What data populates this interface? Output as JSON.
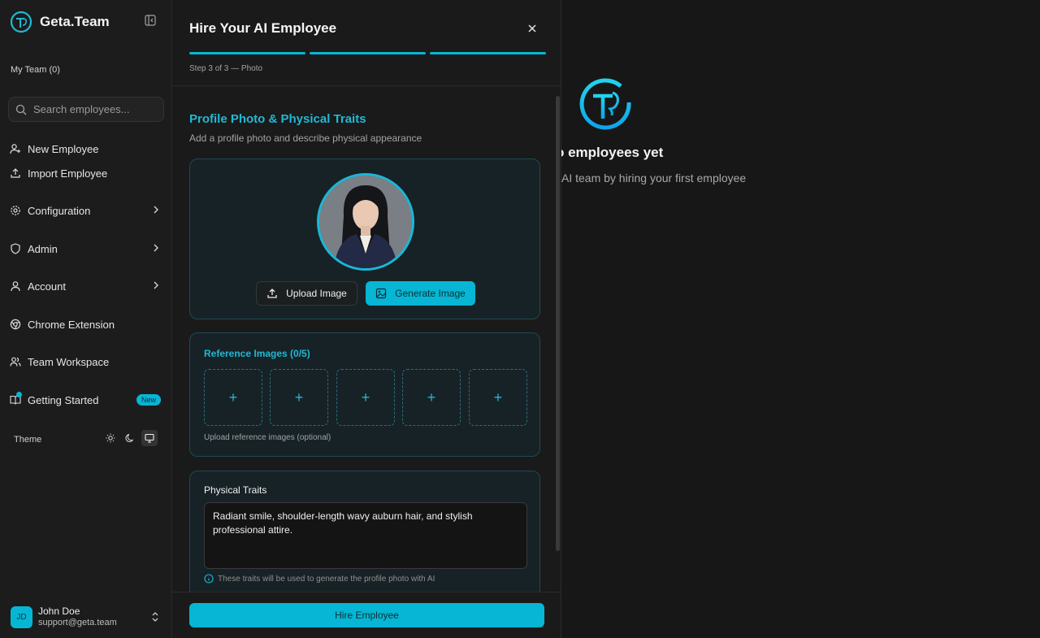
{
  "brand": {
    "name": "Geta.Team"
  },
  "sidebar": {
    "team_label": "My Team (0)",
    "search_placeholder": "Search employees...",
    "items": [
      {
        "label": "New Employee",
        "icon": "user-plus-icon"
      },
      {
        "label": "Import Employee",
        "icon": "upload-icon"
      },
      {
        "label": "Configuration",
        "icon": "gear-icon"
      },
      {
        "label": "Admin",
        "icon": "shield-icon"
      },
      {
        "label": "Account",
        "icon": "user-icon"
      },
      {
        "label": "Chrome Extension",
        "icon": "chrome-icon"
      },
      {
        "label": "Team Workspace",
        "icon": "users-icon"
      },
      {
        "label": "Getting Started",
        "icon": "book-icon",
        "badge": "New"
      }
    ],
    "theme_label": "Theme",
    "user": {
      "initials": "JD",
      "name": "John Doe",
      "email": "support@geta.team"
    }
  },
  "main": {
    "empty_title": "o employees yet",
    "empty_subtitle": "AI team by hiring your first employee"
  },
  "modal": {
    "title": "Hire Your AI Employee",
    "step_label": "Step 3 of 3 — Photo",
    "section_title": "Profile Photo & Physical Traits",
    "section_subtitle": "Add a profile photo and describe physical appearance",
    "upload_label": "Upload Image",
    "generate_label": "Generate Image",
    "reference_title": "Reference Images (0/5)",
    "reference_hint": "Upload reference images (optional)",
    "traits_label": "Physical Traits",
    "traits_value": "Radiant smile, shoulder-length wavy auburn hair, and stylish professional attire.",
    "traits_hint": "These traits will be used to generate the profile photo with AI",
    "hire_label": "Hire Employee"
  },
  "colors": {
    "accent": "#06b6d4",
    "background": "#171717",
    "sidebar": "#1c1c1c"
  }
}
